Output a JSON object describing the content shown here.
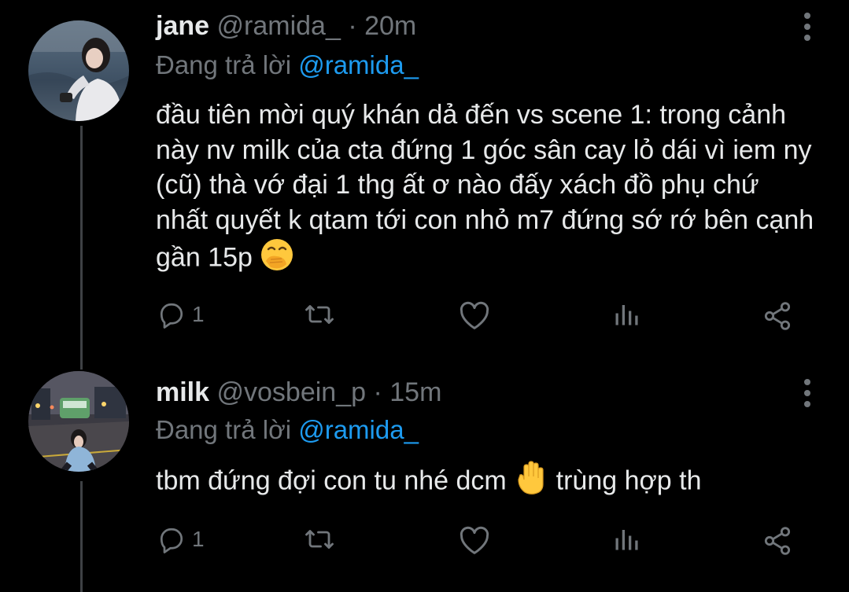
{
  "tweets": [
    {
      "name": "jane",
      "handle": "@ramida_",
      "separator": "·",
      "time": "20m",
      "reply_prefix": "Đang trả lời",
      "reply_to": "@ramida_",
      "text": "đầu tiên mời quý khán dả đến vs scene 1: trong cảnh này nv milk của cta đứng 1 góc sân cay lỏ dái vì iem ny (cũ) thà vớ đại 1 thg ất ơ nào đấy xách đồ phụ chứ nhất quyết k qtam tới con nhỏ m7 đứng sớ rớ bên cạnh gần 15p",
      "emoji": "face-with-hand-over-mouth",
      "reply_count": "1"
    },
    {
      "name": "milk",
      "handle": "@vosbein_p",
      "separator": "·",
      "time": "15m",
      "reply_prefix": "Đang trả lời",
      "reply_to": "@ramida_",
      "text_before": "tbm đứng đợi con tu nhé dcm",
      "emoji": "raised-hand",
      "text_after": "trùng hợp th",
      "reply_count": "1"
    }
  ],
  "icons": {
    "reply": "reply-icon",
    "retweet": "retweet-icon",
    "like": "like-icon",
    "analytics": "analytics-icon",
    "share": "share-icon",
    "more": "more-icon"
  },
  "colors": {
    "background": "#000000",
    "text": "#e7e9ea",
    "muted": "#71767b",
    "mention": "#1d9bf0",
    "thread_line": "#3e4144"
  }
}
